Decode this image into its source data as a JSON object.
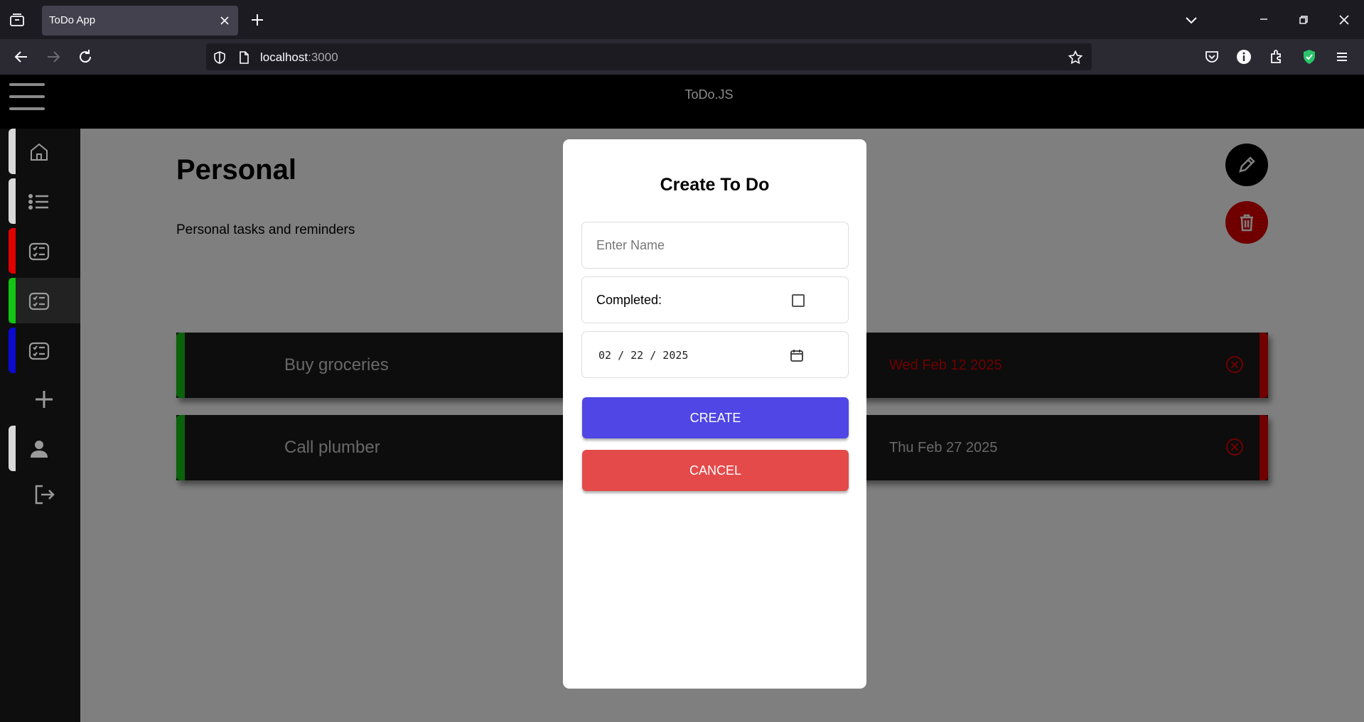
{
  "browser": {
    "tab_title": "ToDo App",
    "url_host": "localhost",
    "url_port": ":3000",
    "icons": [
      "tab-list-icon",
      "tab-close-icon",
      "new-tab-icon",
      "chevron-down-icon",
      "minimize-icon",
      "restore-icon",
      "close-window-icon",
      "back-icon",
      "forward-icon",
      "reload-icon",
      "shield-icon",
      "page-icon",
      "bookmark-star-icon",
      "pocket-icon",
      "info-icon",
      "extensions-icon",
      "ublock-icon",
      "menu-icon"
    ]
  },
  "app": {
    "header_title": "ToDo.JS"
  },
  "sidebar": {
    "colors": {
      "white": "#d9d9d9",
      "red": "#e00000",
      "green": "#14c414",
      "blue": "#0a0ad0"
    }
  },
  "page": {
    "title": "Personal",
    "description": "Personal tasks and reminders"
  },
  "todos": [
    {
      "name": "Buy groceries",
      "date": "Wed Feb 12 2025",
      "overdue": true
    },
    {
      "name": "Call plumber",
      "date": "Thu Feb 27 2025",
      "overdue": false
    }
  ],
  "modal": {
    "title": "Create To Do",
    "name_placeholder": "Enter Name",
    "completed_label": "Completed:",
    "date_value": "02 / 22 / 2025",
    "create_label": "CREATE",
    "cancel_label": "CANCEL"
  },
  "colors": {
    "create_button": "#4f46e5",
    "cancel_button": "#e44a4a",
    "complete_bar": "#14c414",
    "priority_bar": "#e00000",
    "delete_fab": "#e00000"
  }
}
